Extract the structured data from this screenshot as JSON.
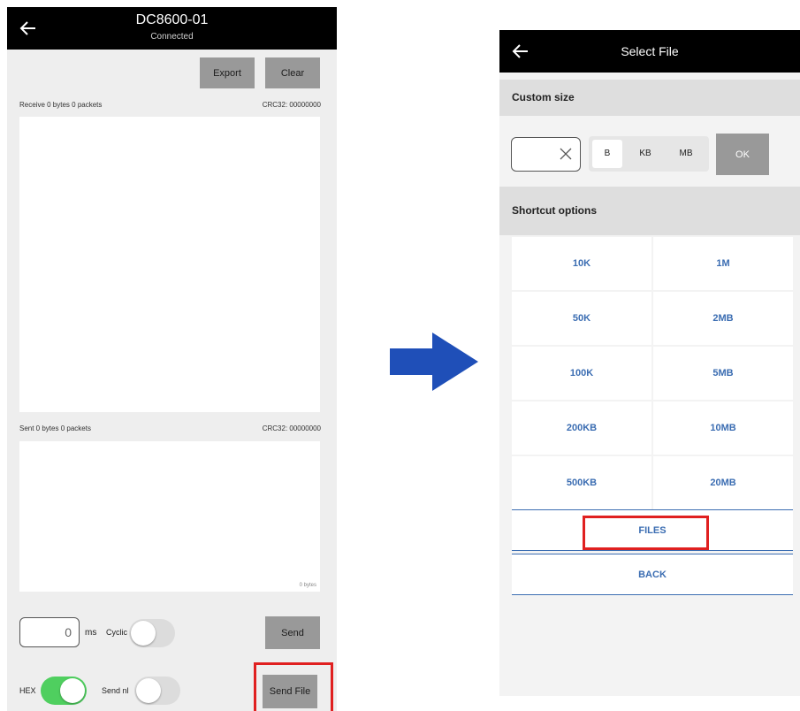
{
  "left_screen": {
    "header": {
      "title": "DC8600-01",
      "subtitle": "Connected",
      "back_icon": "arrow-left-icon"
    },
    "toolbar": {
      "export_label": "Export",
      "clear_label": "Clear"
    },
    "receive": {
      "label": "Receive 0 bytes 0 packets",
      "crc": "CRC32: 00000000"
    },
    "sent": {
      "label": "Sent 0 bytes 0 packets",
      "crc": "CRC32: 00000000",
      "byte_counter": "0 bytes"
    },
    "interval": {
      "value": "0",
      "unit": "ms"
    },
    "cyclic": {
      "label": "Cyclic",
      "enabled": false
    },
    "send_label": "Send",
    "hex": {
      "label": "HEX",
      "enabled": true
    },
    "send_nl": {
      "label": "Send nl",
      "enabled": false
    },
    "send_file_label": "Send File",
    "colors": {
      "header": "#000000",
      "button": "#999999",
      "toggle_on": "#4fcf5f",
      "highlight": "#e02020"
    }
  },
  "transition_icon": "right-arrow-icon",
  "right_screen": {
    "header": {
      "title": "Select File",
      "back_icon": "arrow-left-icon"
    },
    "custom_size": {
      "heading": "Custom size",
      "input_value": "",
      "units": [
        "B",
        "KB",
        "MB"
      ],
      "selected_unit": "B",
      "ok_label": "OK"
    },
    "shortcuts": {
      "heading": "Shortcut options",
      "rows": [
        [
          "10K",
          "1M"
        ],
        [
          "50K",
          "2MB"
        ],
        [
          "100K",
          "5MB"
        ],
        [
          "200KB",
          "10MB"
        ],
        [
          "500KB",
          "20MB"
        ]
      ]
    },
    "files_label": "FILES",
    "back_label": "BACK",
    "colors": {
      "link": "#3b6db2",
      "section": "#dedede",
      "highlight": "#e02020"
    }
  }
}
